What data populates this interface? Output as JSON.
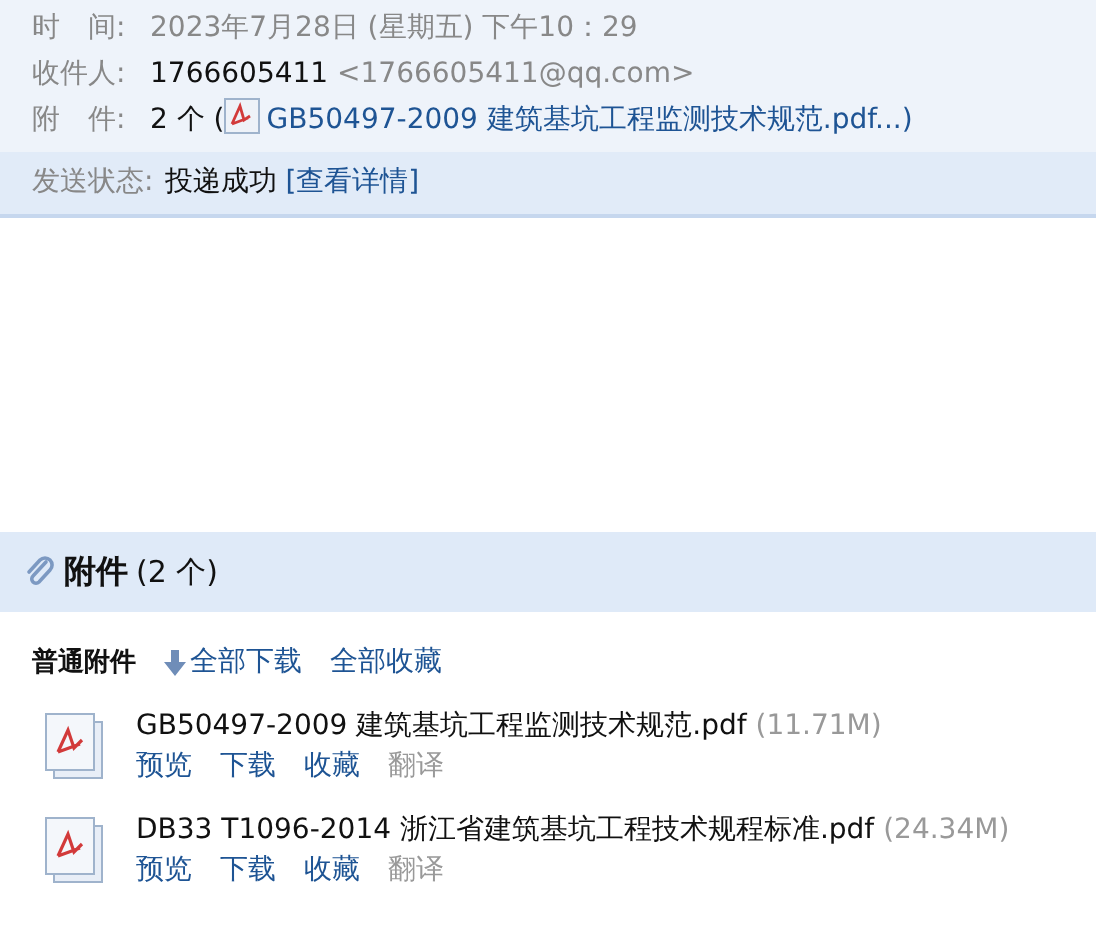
{
  "header": {
    "time": {
      "label": "时　间:",
      "value": "2023年7月28日 (星期五) 下午10：29"
    },
    "recipient": {
      "label": "收件人:",
      "name": "1766605411",
      "address": "<1766605411@qq.com>"
    },
    "attachments": {
      "label": "附　件:",
      "count": "2 个 (",
      "link": "GB50497-2009 建筑基坑工程监测技术规范.pdf...",
      "close": ")"
    }
  },
  "status": {
    "label": "发送状态:",
    "value": "投递成功",
    "link": "[查看详情]"
  },
  "attachment_panel": {
    "title": "附件",
    "count": "(2 个)",
    "group_label": "普通附件",
    "toolbar": [
      "全部下载",
      "全部收藏"
    ],
    "files": [
      {
        "name": "GB50497-2009 建筑基坑工程监测技术规范.pdf",
        "size": "(11.71M)",
        "actions": [
          {
            "label": "预览",
            "disabled": false
          },
          {
            "label": "下载",
            "disabled": false
          },
          {
            "label": "收藏",
            "disabled": false
          },
          {
            "label": "翻译",
            "disabled": true
          }
        ]
      },
      {
        "name": "DB33 T1096-2014 浙江省建筑基坑工程技术规程标准.pdf",
        "size": "(24.34M)",
        "actions": [
          {
            "label": "预览",
            "disabled": false
          },
          {
            "label": "下载",
            "disabled": false
          },
          {
            "label": "收藏",
            "disabled": false
          },
          {
            "label": "翻译",
            "disabled": true
          }
        ]
      }
    ]
  }
}
